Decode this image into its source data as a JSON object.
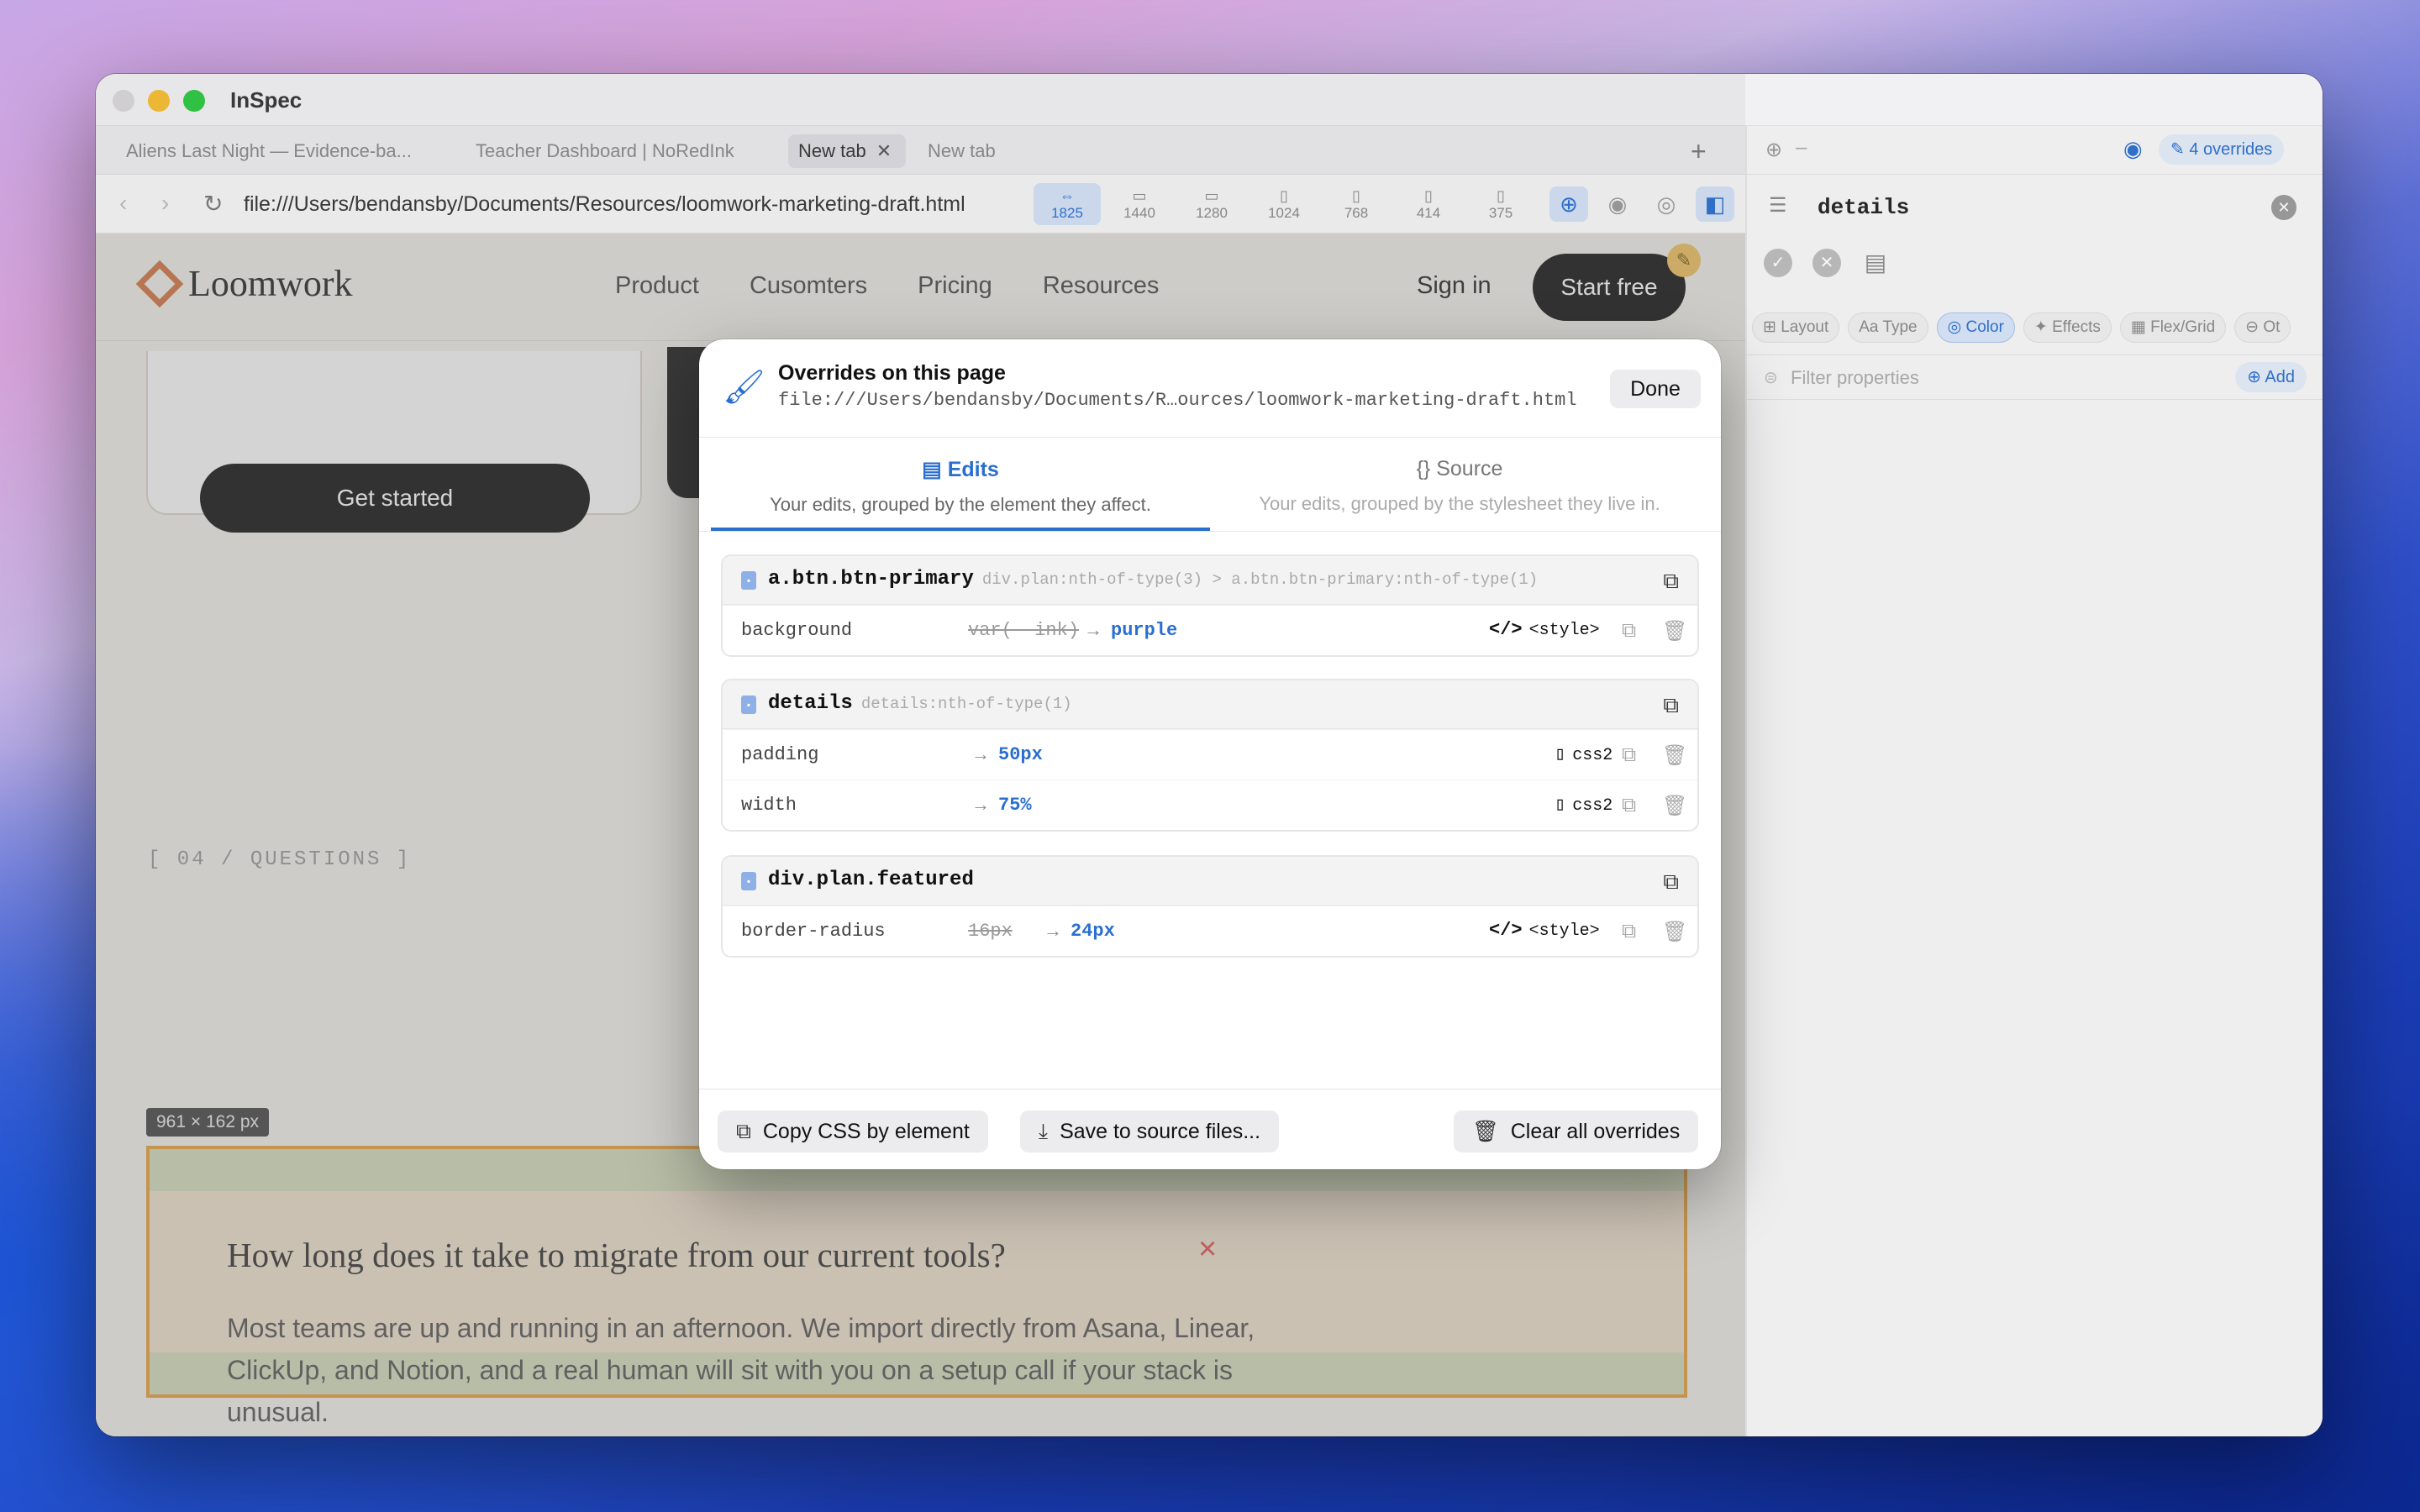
{
  "app": {
    "title": "InSpec"
  },
  "tabs": [
    {
      "label": "Aliens Last Night — Evidence-ba..."
    },
    {
      "label": "Teacher Dashboard | NoRedInk"
    },
    {
      "label": "New tab",
      "active": true
    },
    {
      "label": "New tab"
    }
  ],
  "toolbar": {
    "url": "file:///Users/bendansby/Documents/Resources/loomwork-marketing-draft.html",
    "devices": [
      {
        "icon": "arrows-horizontal-icon",
        "label": "1825",
        "active": true
      },
      {
        "icon": "laptop-icon",
        "label": "1440"
      },
      {
        "icon": "laptop-icon",
        "label": "1280"
      },
      {
        "icon": "tablet-icon",
        "label": "1024"
      },
      {
        "icon": "tablet-icon",
        "label": "768"
      },
      {
        "icon": "phone-icon",
        "label": "414"
      },
      {
        "icon": "phone-icon",
        "label": "375"
      }
    ]
  },
  "site": {
    "logo": "Loomwork",
    "nav": [
      "Product",
      "Cusomters",
      "Pricing",
      "Resources"
    ],
    "signin": "Sign in",
    "start_free": "Start free",
    "get_started": "Get started",
    "section_label": "[ 04 / QUESTIONS ]",
    "dim_badge": "961 × 162 px",
    "faq_question": "How long does it take to migrate from our current tools?",
    "faq_answer": "Most teams are up and running in an afternoon. We import directly from Asana, Linear, ClickUp, and Notion, and a real human will sit with you on a setup call if your stack is unusual.",
    "faq_close": "×"
  },
  "sidebar": {
    "dash": "–",
    "overrides_badge": "4 overrides",
    "title": "details",
    "pills": [
      "Layout",
      "Type",
      "Color",
      "Effects",
      "Flex/Grid",
      "Ot"
    ],
    "pill_icons": [
      "⊞",
      "Aa",
      "◎",
      "✦",
      "▦",
      "⊖"
    ],
    "active_pill": "Color",
    "filter_placeholder": "Filter properties",
    "add_label": "Add"
  },
  "modal": {
    "title": "Overrides on this page",
    "path": "file:///Users/bendansby/Documents/R…ources/loomwork-marketing-draft.html",
    "done": "Done",
    "tab_edits": {
      "label": "Edits",
      "sub": "Your edits, grouped by the element they affect."
    },
    "tab_source": {
      "label": "Source",
      "sub": "Your edits, grouped by the stylesheet they live in."
    },
    "groups": [
      {
        "selector": "a.btn.btn-primary",
        "path": "div.plan:nth-of-type(3) > a.btn.btn-primary:nth-of-type(1)",
        "rows": [
          {
            "prop": "background",
            "old": "var(--ink)",
            "new": "purple",
            "source": "<style>",
            "source_icon": "code-icon"
          }
        ]
      },
      {
        "selector": "details",
        "path": "details:nth-of-type(1)",
        "rows": [
          {
            "prop": "padding",
            "old": "",
            "new": "50px",
            "source": "css2",
            "source_icon": "file-icon"
          },
          {
            "prop": "width",
            "old": "",
            "new": "75%",
            "source": "css2",
            "source_icon": "file-icon"
          }
        ]
      },
      {
        "selector": "div.plan.featured",
        "path": "",
        "rows": [
          {
            "prop": "border-radius",
            "old": "16px",
            "new": "24px",
            "source": "<style>",
            "source_icon": "code-icon"
          }
        ]
      }
    ],
    "copy_css": "Copy CSS by element",
    "save_source": "Save to source files...",
    "clear_all": "Clear all overrides"
  },
  "colors": {
    "accent": "#2a6fcf",
    "brand": "#d4733f",
    "highlight": "#e9a23d"
  }
}
